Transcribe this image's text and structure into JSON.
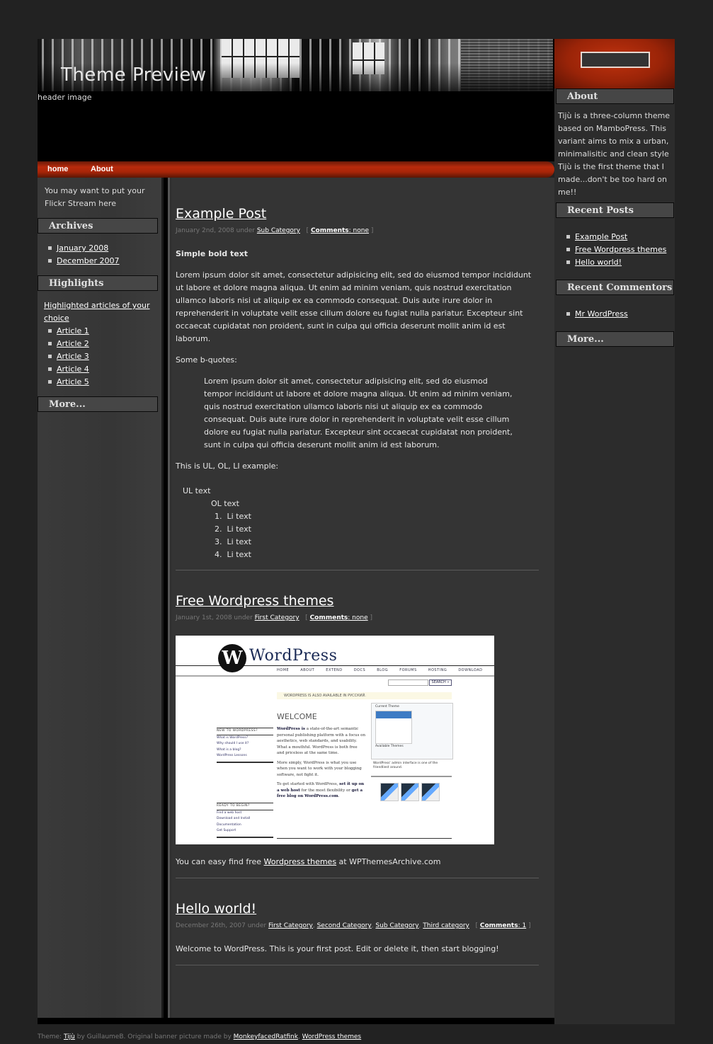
{
  "header": {
    "site_title": "Theme Preview",
    "site_description": "header image"
  },
  "nav": {
    "items": [
      {
        "label": "home"
      },
      {
        "label": "About"
      }
    ]
  },
  "search": {
    "value": "",
    "placeholder": ""
  },
  "left_sidebar": {
    "intro": "You may want to put your Flickr Stream here",
    "archives": {
      "title": "Archives",
      "items": [
        "January 2008",
        "December 2007"
      ]
    },
    "highlights": {
      "title": "Highlights",
      "intro_link": "Highlighted articles of your choice",
      "items": [
        "Article 1",
        "Article 2",
        "Article 3",
        "Article 4",
        "Article 5"
      ]
    },
    "more": {
      "title": "More..."
    }
  },
  "right_sidebar": {
    "about": {
      "title": "About",
      "text": "Tijù is a three-column theme based on MamboPress. This variant aims to mix a urban, minimalisitic and clean style Tijù is the first theme that I made...don't be too hard on me!!"
    },
    "recent_posts": {
      "title": "Recent Posts",
      "items": [
        "Example Post",
        "Free Wordpress themes",
        "Hello world!"
      ]
    },
    "recent_commentors": {
      "title": "Recent Commentors",
      "items": [
        "Mr WordPress"
      ]
    },
    "more": {
      "title": "More..."
    }
  },
  "posts": [
    {
      "title": "Example Post",
      "date": "January 2nd, 2008 under",
      "categories": [
        "Sub Category"
      ],
      "comments_label": "Comments",
      "comments_value": ": none",
      "bold_text": "Simple bold text",
      "paragraph": "Lorem ipsum dolor sit amet, consectetur adipisicing elit, sed do eiusmod tempor incididunt ut labore et dolore magna aliqua. Ut enim ad minim veniam, quis nostrud exercitation ullamco laboris nisi ut aliquip ex ea commodo consequat. Duis aute irure dolor in reprehenderit in voluptate velit esse cillum dolore eu fugiat nulla pariatur. Excepteur sint occaecat cupidatat non proident, sunt in culpa qui officia deserunt mollit anim id est laborum.",
      "bquote_intro": "Some b-quotes:",
      "blockquote": "Lorem ipsum dolor sit amet, consectetur adipisicing elit, sed do eiusmod tempor incididunt ut labore et dolore magna aliqua. Ut enim ad minim veniam, quis nostrud exercitation ullamco laboris nisi ut aliquip ex ea commodo consequat. Duis aute irure dolor in reprehenderit in voluptate velit esse cillum dolore eu fugiat nulla pariatur. Excepteur sint occaecat cupidatat non proident, sunt in culpa qui officia deserunt mollit anim id est laborum.",
      "list_intro": "This is UL, OL, LI example:",
      "ul_text": "UL text",
      "ol_text": "OL text",
      "li_items": [
        "Li text",
        "Li text",
        "Li text",
        "Li text"
      ]
    },
    {
      "title": "Free Wordpress themes",
      "date": "January 1st, 2008 under",
      "categories": [
        "First Category"
      ],
      "comments_label": "Comments",
      "comments_value": ": none",
      "image": {
        "logo_text": "WordPress",
        "nav": [
          "HOME",
          "ABOUT",
          "EXTEND",
          "DOCS",
          "BLOG",
          "FORUMS",
          "HOSTING",
          "DOWNLOAD"
        ],
        "search_button": "SEARCH »",
        "notice": "WORDPRESS IS ALSO AVAILABLE IN РУССКИЙ.",
        "welcome": "WELCOME",
        "body_1_bold": "WordPress is",
        "body_1": " a state-of-the-art semantic personal publishing platform with a focus on aesthetics, web standards, and usability. What a mouthful. WordPress is both free and priceless at the same time.",
        "body_2": "More simply, WordPress is what you use when you want to work with your blogging software, not fight it.",
        "body_3_a": "To get started with WordPress, ",
        "body_3_link1": "set it up on a web host",
        "body_3_b": " for the most flexibility or ",
        "body_3_link2": "get a free blog on WordPress.com",
        "side1_title": "NEW TO WORDPRESS?",
        "side1_items": [
          "What is WordPress?",
          "Why should I use it?",
          "What is a blog?",
          "WordPress Lessons"
        ],
        "side2_title": "READY TO BEGIN?",
        "side2_items": [
          "Find a web host",
          "Download and Install",
          "Documentation",
          "Get Support"
        ],
        "current_theme": "Current Theme",
        "available_themes": "Available Themes",
        "caption": "WordPress' admin interface is one of the friendliest around."
      },
      "text_before": "You can easy find free ",
      "text_link": "Wordpress themes",
      "text_after": " at WPThemesArchive.com"
    },
    {
      "title": "Hello world!",
      "date": "December 26th, 2007 under",
      "categories": [
        "First Category",
        "Second Category",
        "Sub Category",
        "Third category"
      ],
      "comments_label": "Comments",
      "comments_value": ": 1",
      "paragraph": "Welcome to WordPress. This is your first post. Edit or delete it, then start blogging!"
    }
  ],
  "footer": {
    "prefix": "Theme: ",
    "theme_link": "Tijù",
    "middle": " by GuillaumeB. Original banner picture made by ",
    "author_link": "MonkeyfacedRatfink",
    "sep": ", ",
    "themes_link": "WordPress themes"
  },
  "colors": {
    "accent": "#a82508",
    "background": "#222222",
    "main_bg": "#343434",
    "widget_title_bg": "#464646"
  }
}
